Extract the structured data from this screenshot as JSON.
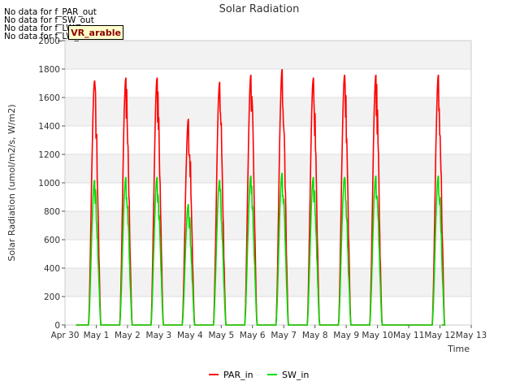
{
  "chart_data": {
    "type": "line",
    "title": "Solar Radiation",
    "xlabel": "Time",
    "ylabel": "Solar Radiation (umol/m2/s, W/m2)",
    "ylim": [
      0,
      2000
    ],
    "yticks": [
      0,
      200,
      400,
      600,
      800,
      1000,
      1200,
      1400,
      1600,
      1800,
      2000
    ],
    "xlim": [
      0,
      13
    ],
    "xtick_labels": [
      "Apr 30",
      "May 1",
      "May 2",
      "May 3",
      "May 4",
      "May 5",
      "May 6",
      "May 7",
      "May 8",
      "May 9",
      "May 10",
      "May 11",
      "May 12",
      "May 13"
    ],
    "grid": "horizontal bands",
    "legend_position": "bottom-center",
    "series": [
      {
        "name": "PAR_in",
        "color": "#ff0000",
        "daily_peaks": [
          {
            "day": "May 1",
            "peak": 1720
          },
          {
            "day": "May 2",
            "peak": 1740
          },
          {
            "day": "May 3",
            "peak": 1740
          },
          {
            "day": "May 4",
            "peak": 1450
          },
          {
            "day": "May 5",
            "peak": 1710
          },
          {
            "day": "May 6",
            "peak": 1760
          },
          {
            "day": "May 7",
            "peak": 1800
          },
          {
            "day": "May 8",
            "peak": 1740
          },
          {
            "day": "May 9",
            "peak": 1760
          },
          {
            "day": "May 10",
            "peak": 1760
          },
          {
            "day": "May 11",
            "peak": 0
          },
          {
            "day": "May 12",
            "peak": 1760
          }
        ]
      },
      {
        "name": "SW_in",
        "color": "#00dd00",
        "daily_peaks": [
          {
            "day": "May 1",
            "peak": 1020
          },
          {
            "day": "May 2",
            "peak": 1040
          },
          {
            "day": "May 3",
            "peak": 1040
          },
          {
            "day": "May 4",
            "peak": 850
          },
          {
            "day": "May 5",
            "peak": 1020
          },
          {
            "day": "May 6",
            "peak": 1050
          },
          {
            "day": "May 7",
            "peak": 1070
          },
          {
            "day": "May 8",
            "peak": 1040
          },
          {
            "day": "May 9",
            "peak": 1040
          },
          {
            "day": "May 10",
            "peak": 1050
          },
          {
            "day": "May 11",
            "peak": 0
          },
          {
            "day": "May 12",
            "peak": 1050
          }
        ]
      }
    ]
  },
  "notes": {
    "no_data": [
      "No data for f_PAR_out",
      "No data for f_SW_out",
      "No data for f_LW_in",
      "No data for f_LW_out"
    ],
    "badge": "VR_arable"
  }
}
